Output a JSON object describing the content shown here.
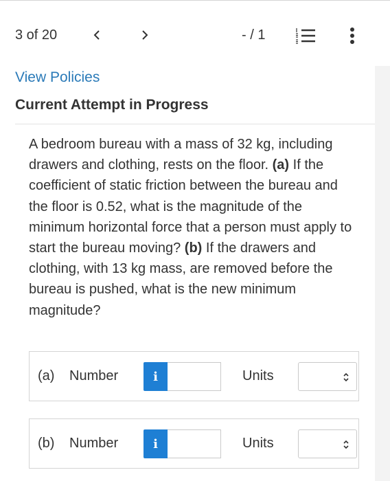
{
  "toolbar": {
    "counter": "3 of 20",
    "score": "- / 1",
    "icons": [
      "chevron-left-icon",
      "chevron-right-icon",
      "numbered-list-icon",
      "more-vertical-icon"
    ]
  },
  "links": {
    "view_policies": "View Policies"
  },
  "section": {
    "title": "Current Attempt in Progress"
  },
  "question": {
    "intro": "A bedroom bureau with a mass of 32 kg, including drawers and clothing, rests on the floor. ",
    "part_a_marker": "(a)",
    "part_a_text": " If the coefficient of static friction between the bureau and the floor is 0.52, what is the magnitude of the minimum horizontal force that a person must apply to start the bureau moving? ",
    "part_b_marker": "(b)",
    "part_b_text": " If the drawers and clothing, with 13 kg mass, are removed before the bureau is pushed, what is the new minimum magnitude?"
  },
  "answers": [
    {
      "part": "(a)",
      "number_label": "Number",
      "info_glyph": "i",
      "value": "",
      "units_label": "Units",
      "units_value": ""
    },
    {
      "part": "(b)",
      "number_label": "Number",
      "info_glyph": "i",
      "value": "",
      "units_label": "Units",
      "units_value": ""
    }
  ],
  "colors": {
    "link": "#2a7ab8",
    "info_button": "#1e7fd4",
    "text": "#333333"
  }
}
